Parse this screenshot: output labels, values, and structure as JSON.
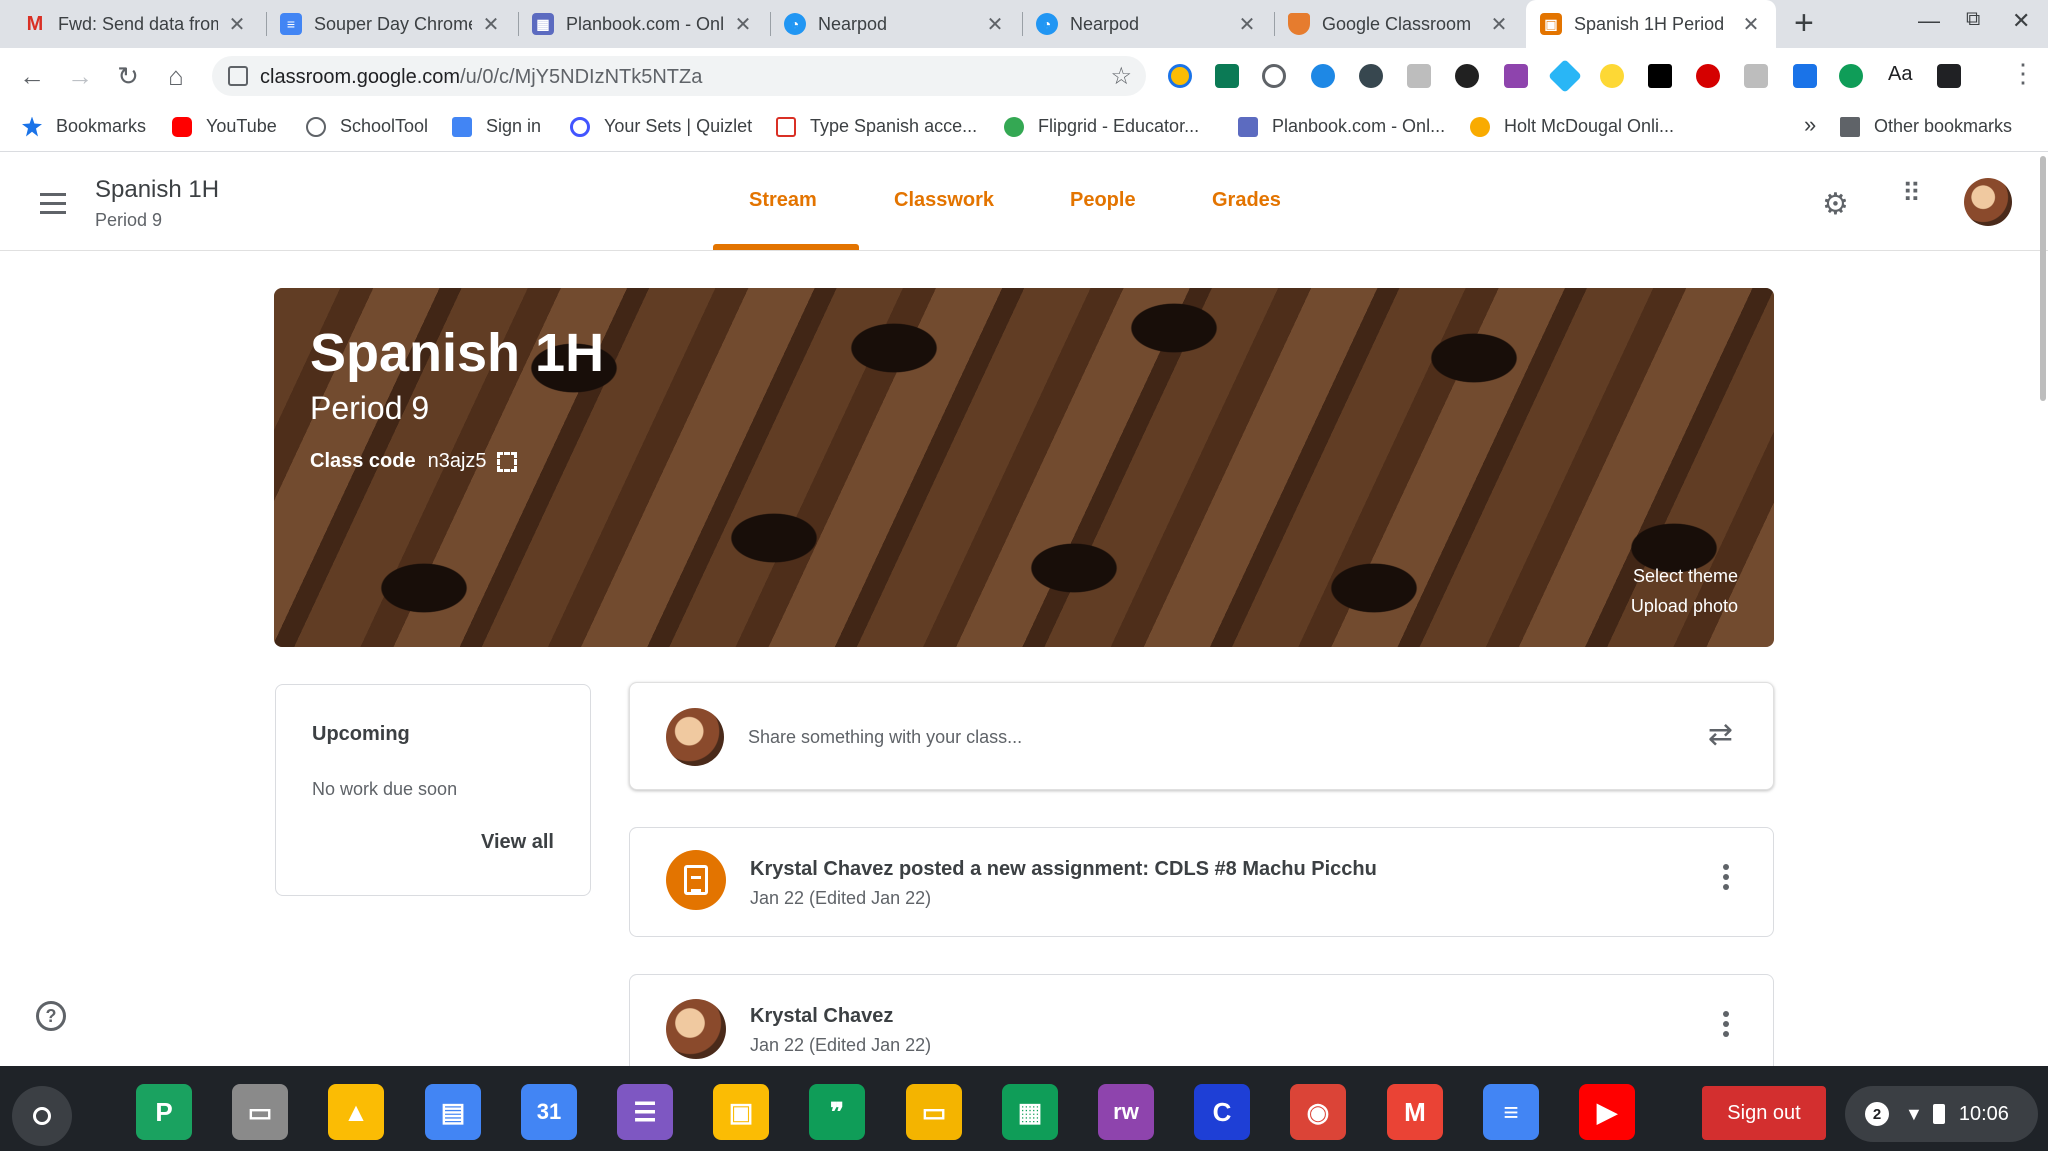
{
  "browser": {
    "tabs": [
      {
        "title": "Fwd: Send data from",
        "favicon": "gmail-icon",
        "color": "#d93025",
        "glyph": "M"
      },
      {
        "title": "Souper Day Chrome",
        "favicon": "docs-icon",
        "color": "#4285f4",
        "glyph": "≡"
      },
      {
        "title": "Planbook.com - Onl",
        "favicon": "planbook-icon",
        "color": "#5c6bc0",
        "glyph": "▦"
      },
      {
        "title": "Nearpod",
        "favicon": "nearpod-icon",
        "color": "#2196f3",
        "glyph": "◔"
      },
      {
        "title": "Nearpod",
        "favicon": "nearpod-icon",
        "color": "#2196f3",
        "glyph": "◔"
      },
      {
        "title": "Google Classroom",
        "favicon": "shield-icon",
        "color": "#e67c2e",
        "glyph": "◆"
      },
      {
        "title": "Spanish 1H Period",
        "favicon": "classroom-icon",
        "color": "#e37400",
        "glyph": "▣"
      }
    ],
    "url_host": "classroom.google.com",
    "url_path": "/u/0/c/MjY5NDIzNTk5NTZa"
  },
  "bookmarks": [
    {
      "label": "Bookmarks",
      "icon": "star-icon",
      "color": "#1a73e8"
    },
    {
      "label": "YouTube",
      "icon": "youtube-icon",
      "color": "#ff0000"
    },
    {
      "label": "SchoolTool",
      "icon": "schooltool-icon",
      "color": "#5f6368"
    },
    {
      "label": "Sign in",
      "icon": "signin-icon",
      "color": "#4285f4"
    },
    {
      "label": "Your Sets | Quizlet",
      "icon": "quizlet-icon",
      "color": "#4255ff"
    },
    {
      "label": "Type Spanish acce...",
      "icon": "type-icon",
      "color": "#d93025"
    },
    {
      "label": "Flipgrid - Educator...",
      "icon": "flipgrid-icon",
      "color": "#34a853"
    },
    {
      "label": "Planbook.com - Onl...",
      "icon": "planbook-icon",
      "color": "#5c6bc0"
    },
    {
      "label": "Holt McDougal Onli...",
      "icon": "holt-icon",
      "color": "#f9ab00"
    }
  ],
  "bookmarks_overflow": "»",
  "other_bookmarks": "Other bookmarks",
  "classroom": {
    "class_name": "Spanish 1H",
    "section": "Period 9",
    "tabs": [
      "Stream",
      "Classwork",
      "People",
      "Grades"
    ],
    "active_tab": "Stream",
    "accent": "#e37400"
  },
  "banner": {
    "title": "Spanish 1H",
    "section": "Period 9",
    "class_code_label": "Class code",
    "class_code": "n3ajz5",
    "select_theme": "Select theme",
    "upload_photo": "Upload photo"
  },
  "upcoming": {
    "title": "Upcoming",
    "empty": "No work due soon",
    "view_all": "View all"
  },
  "share": {
    "placeholder": "Share something with your class..."
  },
  "posts": [
    {
      "title": "Krystal Chavez posted a new assignment: CDLS #8 Machu Picchu",
      "date": "Jan 22 (Edited Jan 22)"
    },
    {
      "title": "Krystal Chavez",
      "date": "Jan 22 (Edited Jan 22)"
    }
  ],
  "shelf": {
    "sign_out": "Sign out",
    "notifications": "2",
    "time": "10:06",
    "apps": [
      {
        "name": "pear-deck-icon",
        "color": "#1aa260",
        "glyph": "P"
      },
      {
        "name": "screencast-icon",
        "color": "#8a8a8a",
        "glyph": "▭"
      },
      {
        "name": "drive-icon",
        "color": "#fbbc04",
        "glyph": "▲"
      },
      {
        "name": "docs-files-icon",
        "color": "#4285f4",
        "glyph": "▤"
      },
      {
        "name": "calendar-icon",
        "color": "#4285f4",
        "glyph": "31"
      },
      {
        "name": "forms-icon",
        "color": "#7e57c2",
        "glyph": "☰"
      },
      {
        "name": "classroom-icon",
        "color": "#fbbc04",
        "glyph": "▣"
      },
      {
        "name": "hangouts-icon",
        "color": "#0f9d58",
        "glyph": "❞"
      },
      {
        "name": "slides-icon",
        "color": "#f4b400",
        "glyph": "▭"
      },
      {
        "name": "sheets-icon",
        "color": "#0f9d58",
        "glyph": "▦"
      },
      {
        "name": "readwrite-icon",
        "color": "#8e44ad",
        "glyph": "rw"
      },
      {
        "name": "c-app-icon",
        "color": "#1e3fd6",
        "glyph": "C"
      },
      {
        "name": "chrome-icon",
        "color": "#db4437",
        "glyph": "◉"
      },
      {
        "name": "gmail-icon",
        "color": "#ea4335",
        "glyph": "M"
      },
      {
        "name": "docs-icon",
        "color": "#4285f4",
        "glyph": "≡"
      },
      {
        "name": "youtube-icon",
        "color": "#ff0000",
        "glyph": "▶"
      }
    ]
  }
}
